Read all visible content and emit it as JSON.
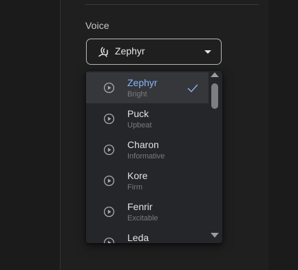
{
  "voice": {
    "label": "Voice",
    "selected": "Zephyr"
  },
  "options": [
    {
      "name": "Zephyr",
      "desc": "Bright",
      "selected": true
    },
    {
      "name": "Puck",
      "desc": "Upbeat",
      "selected": false
    },
    {
      "name": "Charon",
      "desc": "Informative",
      "selected": false
    },
    {
      "name": "Kore",
      "desc": "Firm",
      "selected": false
    },
    {
      "name": "Fenrir",
      "desc": "Excitable",
      "selected": false
    },
    {
      "name": "Leda",
      "desc": "",
      "selected": false
    }
  ],
  "icons": {
    "select": "voice-wave-icon",
    "option": "play-circle-icon",
    "selected_marker": "check-icon",
    "dropdown_caret": "caret-down-icon",
    "scroll_up": "scroll-up-arrow-icon",
    "scroll_down": "scroll-down-arrow-icon"
  },
  "colors": {
    "accent": "#8ab4f8",
    "menu_bg": "#25262a",
    "selected_bg": "#36373b",
    "page_bg": "#1c1c1c"
  }
}
